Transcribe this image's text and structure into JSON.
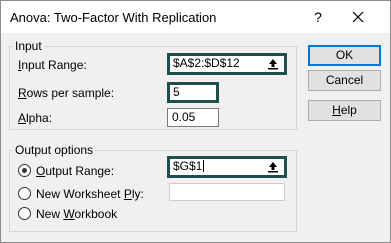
{
  "dialog": {
    "title": "Anova: Two-Factor With Replication",
    "help_glyph": "?",
    "close_icon": "close-icon"
  },
  "input_group": {
    "label": "Input",
    "input_range": {
      "label_prefix": "I",
      "label_rest": "nput Range:",
      "value": "$A$2:$D$12",
      "ref_icon": "collapse-dialog-icon"
    },
    "rows_per_sample": {
      "label_prefix": "R",
      "label_rest": "ows per sample:",
      "value": "5"
    },
    "alpha": {
      "label_prefix": "A",
      "label_rest": "lpha:",
      "value": "0.05"
    }
  },
  "output_group": {
    "label": "Output options",
    "output_range": {
      "label_prefix": "O",
      "label_rest": "utput Range:",
      "value": "$G$1",
      "selected": true,
      "ref_icon": "collapse-dialog-icon"
    },
    "new_worksheet": {
      "label_main": "New Worksheet ",
      "label_u": "P",
      "label_end": "ly:",
      "value": "",
      "selected": false
    },
    "new_workbook": {
      "label_main": "New ",
      "label_u": "W",
      "label_end": "orkbook",
      "selected": false
    }
  },
  "buttons": {
    "ok": "OK",
    "cancel": "Cancel",
    "help_prefix": "H",
    "help_rest": "elp"
  },
  "colors": {
    "focus_border": "#1f4e4e",
    "default_button_border": "#0078d7",
    "dialog_bg": "#f0f0f0"
  }
}
